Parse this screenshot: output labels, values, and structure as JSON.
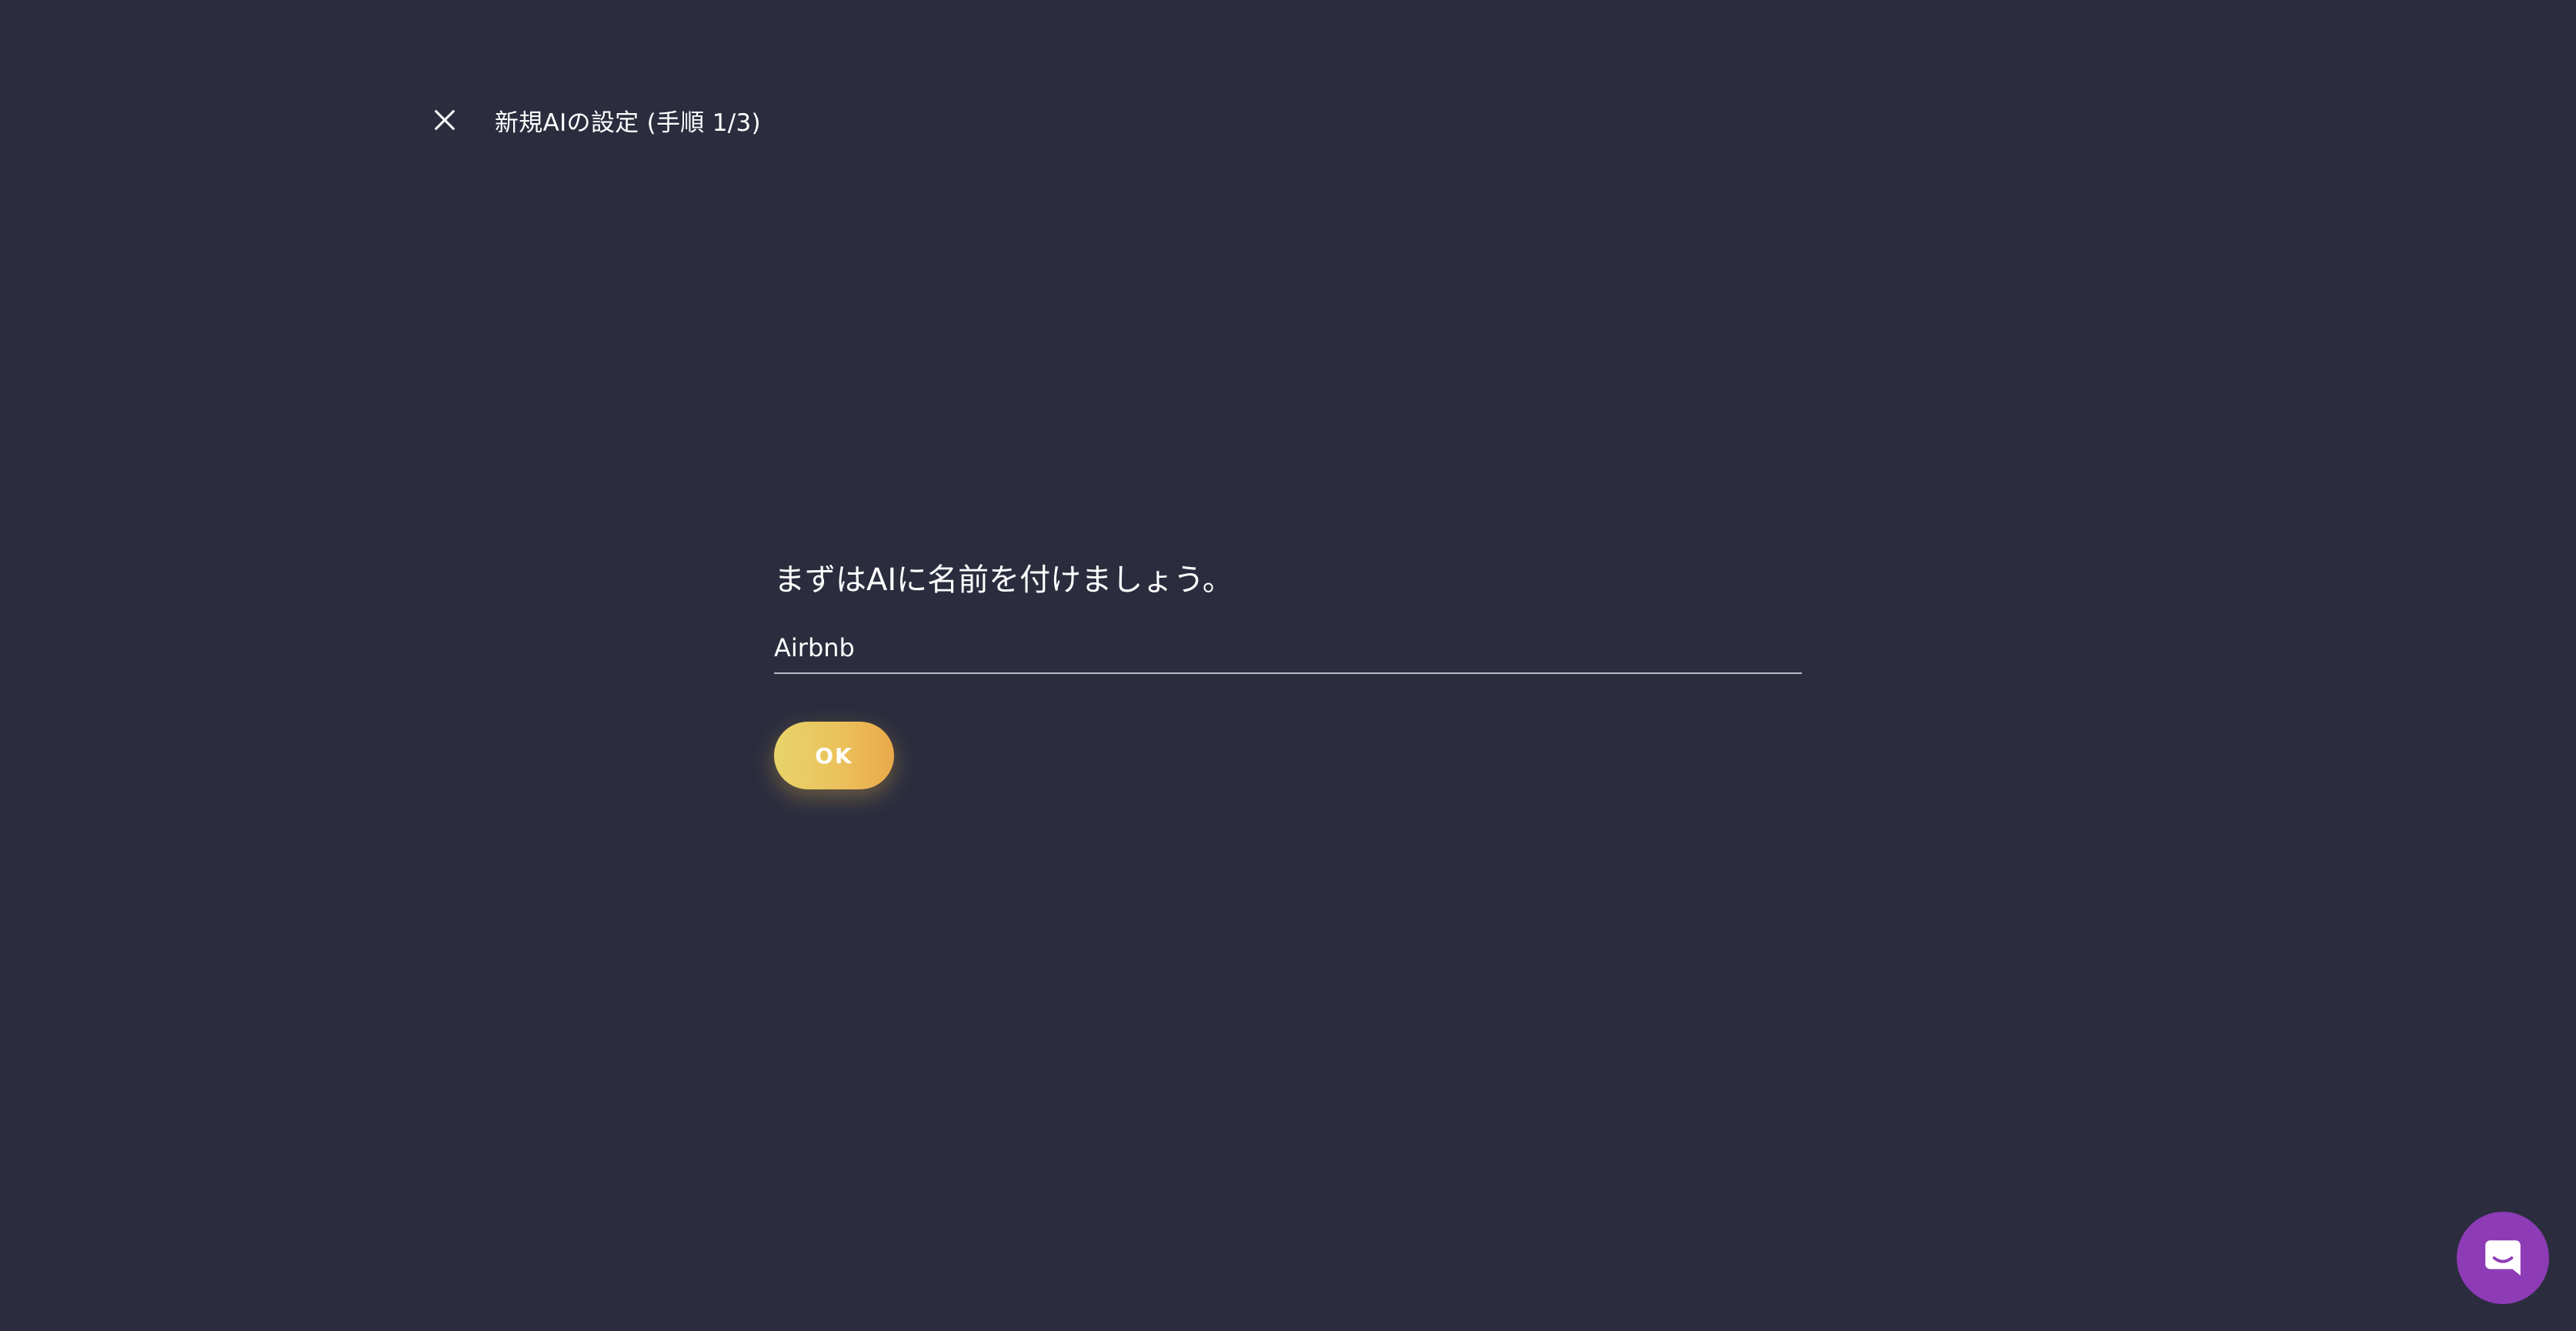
{
  "header": {
    "close_icon": "close-icon",
    "title": "新規AIの設定 (手順 1/3)"
  },
  "form": {
    "prompt": "まずはAIに名前を付けましょう。",
    "name_value": "Airbnb",
    "ok_label": "OK"
  },
  "chat_launcher": {
    "icon": "chat-bubble-icon"
  },
  "colors": {
    "background": "#2b2d3e",
    "accent_start": "#e8d46a",
    "accent_end": "#e9a94a",
    "chat_launcher": "#8e3bb6"
  }
}
